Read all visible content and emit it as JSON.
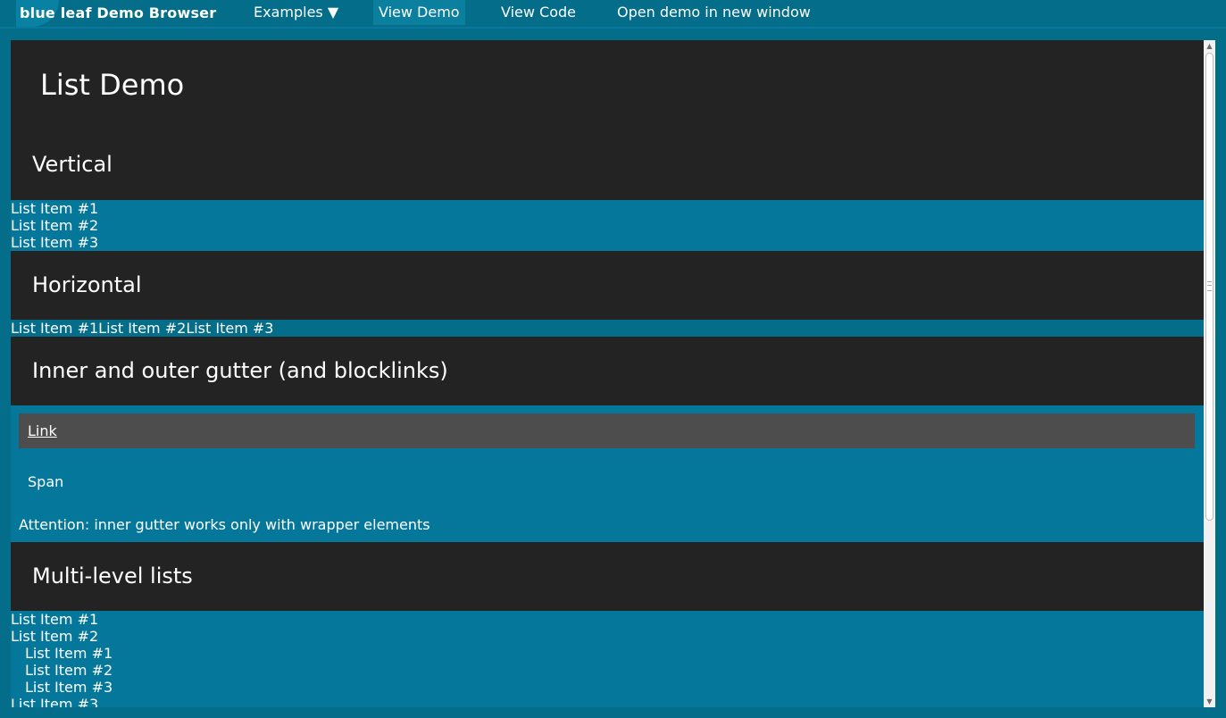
{
  "app": {
    "brand": "blue leaf Demo Browser",
    "nav": {
      "examples": "Examples ▼",
      "view_demo": "View Demo",
      "view_code": "View Code",
      "open_new": "Open demo in new window"
    }
  },
  "page": {
    "title": "List Demo",
    "sections": {
      "vertical": {
        "heading": "Vertical",
        "items": [
          "List Item #1",
          "List Item #2",
          "List Item #3"
        ]
      },
      "horizontal": {
        "heading": "Horizontal",
        "items": [
          "List Item #1",
          "List Item #2",
          "List Item #3"
        ]
      },
      "gutter": {
        "heading": "Inner and outer gutter (and blocklinks)",
        "link": "Link",
        "span": "Span",
        "note": "Attention: inner gutter works only with wrapper elements"
      },
      "multilevel": {
        "heading": "Multi-level lists",
        "items": [
          "List Item #1",
          "List Item #2",
          "List Item #3"
        ],
        "sub_items": [
          "List Item #1",
          "List Item #2",
          "List Item #3"
        ]
      }
    }
  },
  "colors": {
    "background": "#036d8a",
    "panel": "#04779a",
    "heading_bg": "#232323",
    "blocklink_bg": "#4d4d4d"
  }
}
